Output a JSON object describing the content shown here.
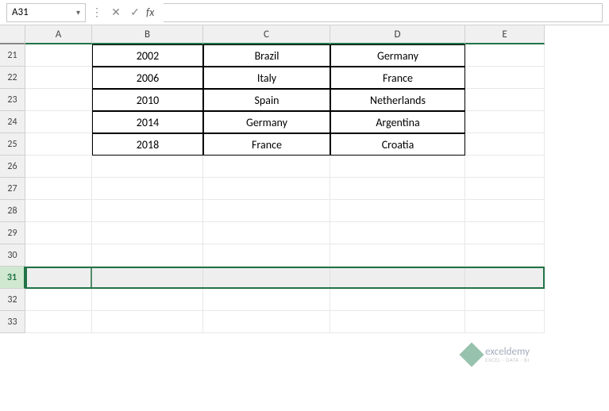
{
  "formula_bar": {
    "cell_reference": "A31",
    "fx_label": "fx",
    "formula_value": ""
  },
  "columns": [
    "A",
    "B",
    "C",
    "D",
    "E"
  ],
  "visible_rows": [
    21,
    22,
    23,
    24,
    25,
    26,
    27,
    28,
    29,
    30,
    31,
    32,
    33
  ],
  "selected_row": 31,
  "table_data": {
    "rows": [
      {
        "year": "2002",
        "winner": "Brazil",
        "runner_up": "Germany"
      },
      {
        "year": "2006",
        "winner": "Italy",
        "runner_up": "France"
      },
      {
        "year": "2010",
        "winner": "Spain",
        "runner_up": "Netherlands"
      },
      {
        "year": "2014",
        "winner": "Germany",
        "runner_up": "Argentina"
      },
      {
        "year": "2018",
        "winner": "France",
        "runner_up": "Croatia"
      }
    ]
  },
  "watermark": {
    "brand": "exceldemy",
    "tagline": "EXCEL · DATA · BI"
  },
  "icons": {
    "cancel": "✕",
    "confirm": "✓",
    "dropdown": "▾",
    "divider": "⋮"
  }
}
